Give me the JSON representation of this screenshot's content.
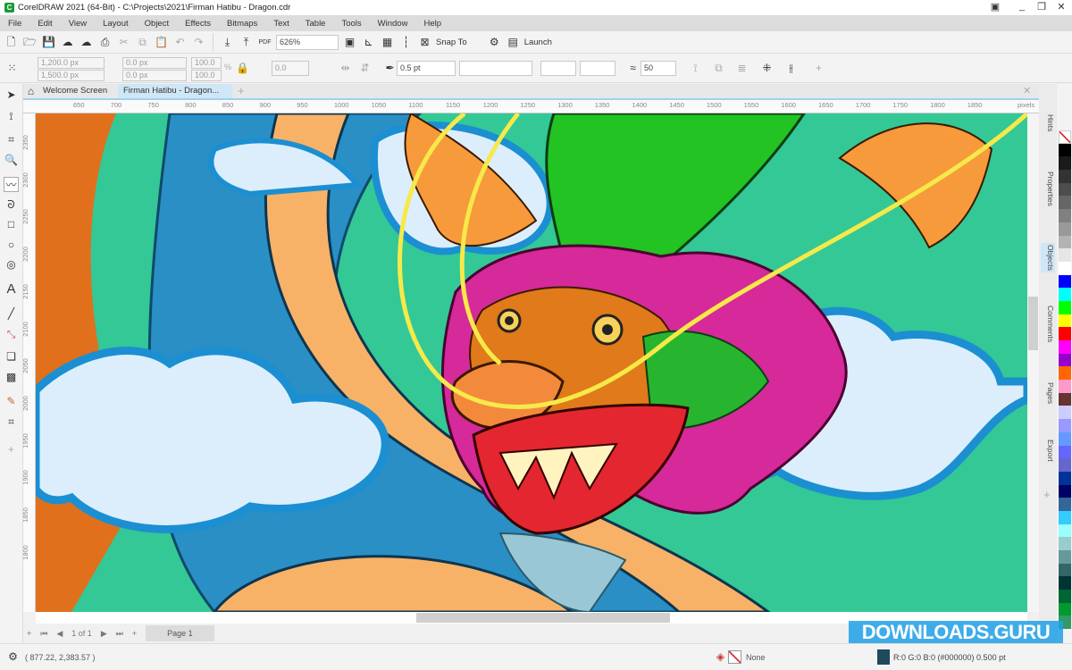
{
  "window": {
    "title": "CorelDRAW 2021 (64-Bit) - C:\\Projects\\2021\\Firman Hatibu - Dragon.cdr"
  },
  "menu": [
    "File",
    "Edit",
    "View",
    "Layout",
    "Object",
    "Effects",
    "Bitmaps",
    "Text",
    "Table",
    "Tools",
    "Window",
    "Help"
  ],
  "toolbar": {
    "zoom": "626%",
    "snap_to": "Snap To",
    "launch": "Launch",
    "pdf": "PDF"
  },
  "propbar": {
    "width": "1,200.0 px",
    "height": "1,500.0 px",
    "pos_x": "0.0 px",
    "pos_y": "0.0 px",
    "scale_x": "100.0",
    "scale_y": "100.0",
    "pct": "%",
    "rotation": "0.0",
    "outline_width": "0.5 pt",
    "smoothing": "50"
  },
  "tabs": [
    {
      "label": "Welcome Screen"
    },
    {
      "label": "Firman Hatibu - Dragon..."
    }
  ],
  "ruler": {
    "h": [
      "650",
      "700",
      "750",
      "800",
      "850",
      "900",
      "950",
      "1000",
      "1050",
      "1100",
      "1150",
      "1200",
      "1250",
      "1300",
      "1350",
      "1400",
      "1450",
      "1500",
      "1550",
      "1600",
      "1650",
      "1700",
      "1750",
      "1800",
      "1850"
    ],
    "unit": "pixels",
    "v": [
      "2350",
      "2300",
      "2250",
      "2200",
      "2150",
      "2100",
      "2050",
      "2000",
      "1950",
      "1900",
      "1850",
      "1800"
    ]
  },
  "pagenav": {
    "count": "1 of 1",
    "page": "Page 1"
  },
  "status": {
    "coords": "( 877.22, 2,383.57 )",
    "fill": "None",
    "outline": "R:0 G:0 B:0 (#000000)  0.500 pt"
  },
  "docker": [
    "Hints",
    "Properties",
    "Objects",
    "Comments",
    "Pages",
    "Export"
  ],
  "palette": [
    "#000000",
    "#1a1a1a",
    "#333333",
    "#4d4d4d",
    "#666666",
    "#808080",
    "#999999",
    "#b3b3b3",
    "#e6e6e6",
    "#ffffff",
    "#0000ff",
    "#00ffff",
    "#00ff00",
    "#ffff00",
    "#ff0000",
    "#ff00ff",
    "#9900cc",
    "#ff6600",
    "#ff99cc",
    "#663333",
    "#ccccff",
    "#9999ff",
    "#6699ff",
    "#6666ff",
    "#6666cc",
    "#003399",
    "#000066",
    "#336699",
    "#33ccff",
    "#99ffff",
    "#99cccc",
    "#669999",
    "#336666",
    "#003333",
    "#006633",
    "#009933",
    "#339966"
  ],
  "canvas_colors": {
    "background": "#33c896",
    "body_scales": "#2a8fc4",
    "belly": "#f7b267",
    "cloud": "#dceefc",
    "cloud_outline": "#1b8fd1",
    "head": "#d6299a",
    "horns": "#22c322",
    "whisker": "#f6e94a"
  },
  "watermark": "DOWNLOADS.GURU"
}
